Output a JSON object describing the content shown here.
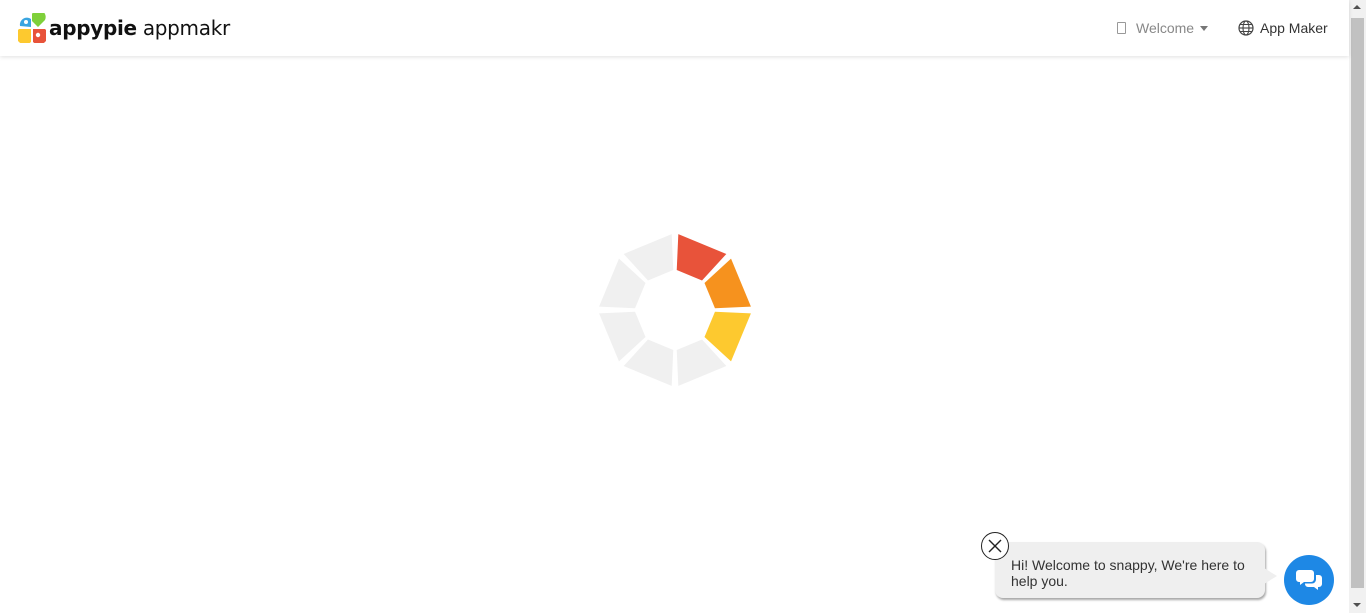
{
  "header": {
    "brand": "appypie",
    "product": "appmakr",
    "welcome_label": "Welcome",
    "app_maker_label": "App Maker"
  },
  "loader": {
    "colors": {
      "segment_1": "#e8533a",
      "segment_2": "#f6921e",
      "segment_3": "#fdc92f",
      "inactive": "#f0f0f0"
    }
  },
  "chat": {
    "message": "Hi! Welcome to snappy, We're here to help you.",
    "button_color": "#1e88e5"
  },
  "icons": {
    "header_left": "appypie-logo-icon",
    "welcome": "mobile-icon",
    "app_maker": "globe-icon",
    "close": "close-icon",
    "chat": "chat-bubbles-icon"
  }
}
